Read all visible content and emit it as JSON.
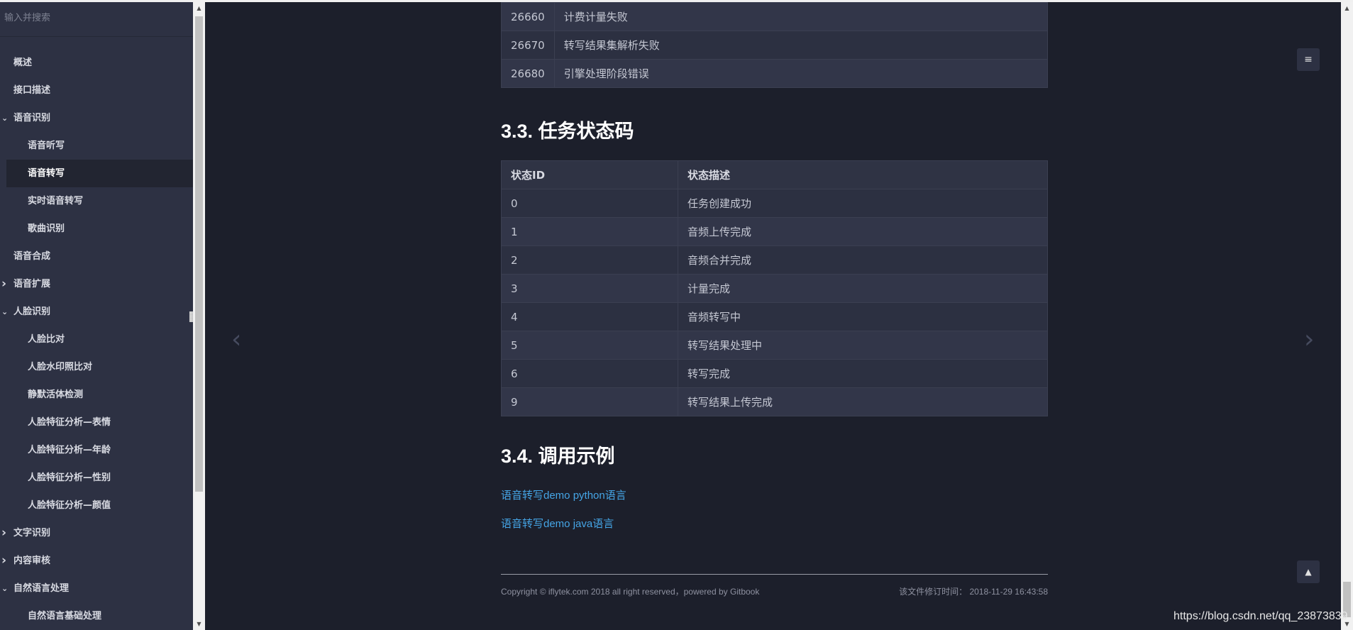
{
  "search": {
    "placeholder": "输入并搜索"
  },
  "sidebar": {
    "items": [
      {
        "label": "概述",
        "level": 1,
        "icon": ""
      },
      {
        "label": "接口描述",
        "level": 1,
        "icon": ""
      },
      {
        "label": "语音识别",
        "level": 1,
        "icon": "chevron-down-icon"
      },
      {
        "label": "语音听写",
        "level": 2,
        "icon": ""
      },
      {
        "label": "语音转写",
        "level": 2,
        "icon": "",
        "active": true
      },
      {
        "label": "实时语音转写",
        "level": 2,
        "icon": ""
      },
      {
        "label": "歌曲识别",
        "level": 2,
        "icon": ""
      },
      {
        "label": "语音合成",
        "level": 1,
        "icon": ""
      },
      {
        "label": "语音扩展",
        "level": 1,
        "icon": "chevron-right-icon"
      },
      {
        "label": "人脸识别",
        "level": 1,
        "icon": "chevron-down-icon"
      },
      {
        "label": "人脸比对",
        "level": 2,
        "icon": ""
      },
      {
        "label": "人脸水印照比对",
        "level": 2,
        "icon": ""
      },
      {
        "label": "静默活体检测",
        "level": 2,
        "icon": ""
      },
      {
        "label": "人脸特征分析—表情",
        "level": 2,
        "icon": ""
      },
      {
        "label": "人脸特征分析—年龄",
        "level": 2,
        "icon": ""
      },
      {
        "label": "人脸特征分析—性别",
        "level": 2,
        "icon": ""
      },
      {
        "label": "人脸特征分析—颜值",
        "level": 2,
        "icon": ""
      },
      {
        "label": "文字识别",
        "level": 1,
        "icon": "chevron-right-icon"
      },
      {
        "label": "内容审核",
        "level": 1,
        "icon": "chevron-right-icon"
      },
      {
        "label": "自然语言处理",
        "level": 1,
        "icon": "chevron-down-icon"
      },
      {
        "label": "自然语言基础处理",
        "level": 2,
        "icon": ""
      }
    ]
  },
  "error_table": {
    "rows": [
      [
        "26660",
        "计费计量失败"
      ],
      [
        "26670",
        "转写结果集解析失败"
      ],
      [
        "26680",
        "引擎处理阶段错误"
      ]
    ]
  },
  "section_33": {
    "title": "3.3. 任务状态码"
  },
  "state_table": {
    "headers": [
      "状态ID",
      "状态描述"
    ],
    "rows": [
      [
        "0",
        "任务创建成功"
      ],
      [
        "1",
        "音频上传完成"
      ],
      [
        "2",
        "音频合并完成"
      ],
      [
        "3",
        "计量完成"
      ],
      [
        "4",
        "音频转写中"
      ],
      [
        "5",
        "转写结果处理中"
      ],
      [
        "6",
        "转写完成"
      ],
      [
        "9",
        "转写结果上传完成"
      ]
    ]
  },
  "section_34": {
    "title": "3.4. 调用示例"
  },
  "links": [
    "语音转写demo python语言",
    "语音转写demo java语言"
  ],
  "footer": {
    "copyright": "Copyright © iflytek.com 2018 all right reserved，powered by Gitbook",
    "modified": "该文件修订时间： 2018-11-29 16:43:58"
  },
  "watermark": "https://blog.csdn.net/qq_23873839",
  "colors": {
    "background": "#1c1f2b",
    "sidebar": "#2d3143",
    "link": "#45a5e6"
  }
}
